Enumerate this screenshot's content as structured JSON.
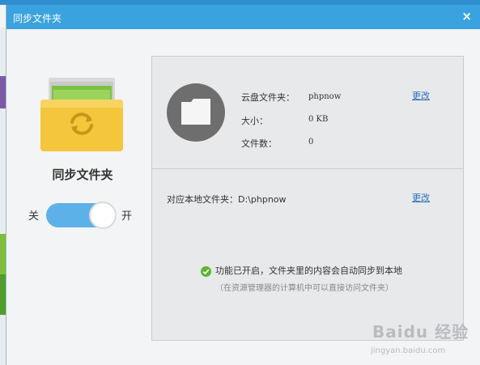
{
  "window": {
    "title": "同步文件夹",
    "close_label": "×"
  },
  "folder": {
    "name": "同步文件夹"
  },
  "toggle": {
    "off_label": "关",
    "on_label": "开",
    "state": "on"
  },
  "cloud": {
    "folder_label": "云盘文件夹：",
    "folder_value": "phpnow",
    "size_label": "大小：",
    "size_value": "0 KB",
    "count_label": "文件数：",
    "count_value": "0",
    "change_label": "更改"
  },
  "local": {
    "label": "对应本地文件夹：D:\\phpnow",
    "change_label": "更改"
  },
  "status": {
    "message": "功能已开启，文件夹里的内容会自动同步到本地",
    "hint": "（在资源管理器的计算机中可以直接访问文件夹）"
  },
  "watermark": {
    "text": "Baidu 经验",
    "sub": "jingyan.baidu.com"
  },
  "colors": {
    "titlebar": "#3aa3df",
    "toggle_on": "#5cb1e8",
    "link": "#2a6ebb",
    "check": "#5cb531"
  }
}
